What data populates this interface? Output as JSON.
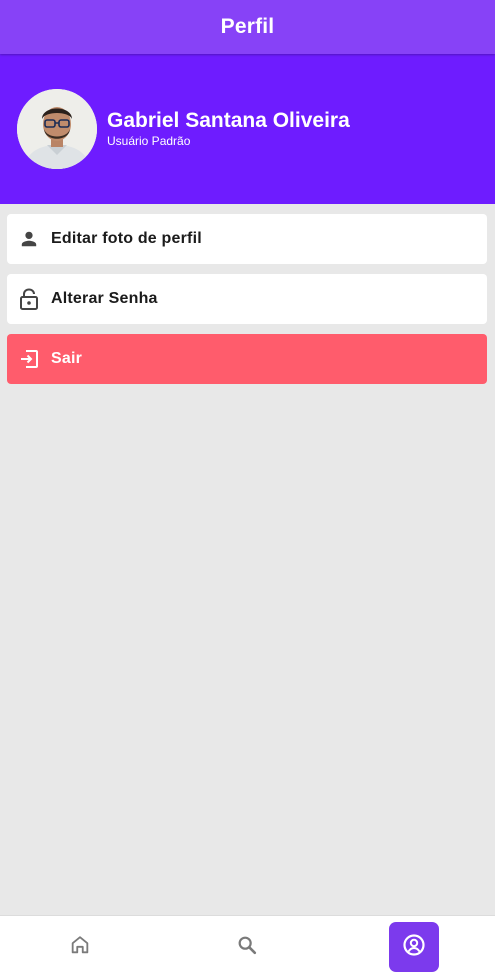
{
  "header": {
    "title": "Perfil"
  },
  "profile": {
    "name": "Gabriel Santana Oliveira",
    "role": "Usuário Padrão"
  },
  "menu": {
    "items": [
      {
        "label": "Editar foto de perfil",
        "icon": "person-icon"
      },
      {
        "label": "Alterar Senha",
        "icon": "lock-open-icon"
      },
      {
        "label": "Sair",
        "icon": "logout-icon"
      }
    ]
  },
  "bottom_nav": {
    "items": [
      {
        "icon": "home-icon",
        "active": false
      },
      {
        "icon": "search-icon",
        "active": false
      },
      {
        "icon": "account-circle-icon",
        "active": true
      }
    ]
  },
  "colors": {
    "topbar": "#8742f7",
    "profile_bg": "#6e1cff",
    "page_bg": "#e8e8e8",
    "danger": "#ff5c6c",
    "active_tab": "#7c3aed"
  }
}
